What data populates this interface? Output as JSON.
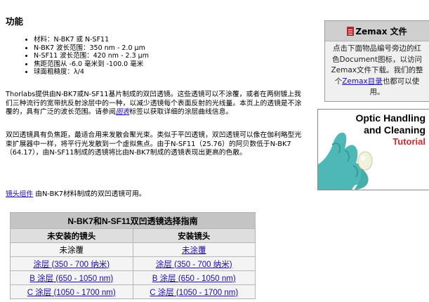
{
  "features": {
    "heading": "功能",
    "items": [
      "材料：N-BK7 或 N-SF11",
      "N-BK7 波长范围：350 nm - 2.0 μm",
      "N-SF11 波长范围：420 nm - 2.3 μm",
      "焦距范围从 -6.0 毫米到 -100.0 毫米",
      "球面粗糙度：λ/4"
    ]
  },
  "paragraphs": {
    "p1_a": "Thorlabs提供由N-BK7或N-SF11基片制成的双凹透镜。这些透镜可以不涂覆，或者在两侧镀上我们三种流行的宽带抗反射涂层中的一种，以减少透镜每个表面反射的光线量。本页上的透镜是不涂覆的，具有广泛的波长范围。请参阅",
    "p1_link": "图表",
    "p1_b": "标签以获取详细的涂层曲线信息。",
    "p2": "双凹透镜具有负焦距，最适合用来发散会聚光束。类似于平凹透镜，双凹透镜可以像在伽利略型光束扩展器中一样，将平行光发散到一个虚拟焦点。由于N-SF11（25.76）的阿贝数低于N-BK7（64.17），由N-SF11制成的透镜将比由N-BK7制成的透镜表现出更高的色散。",
    "p3_link": "镜头组件",
    "p3_b": " 由N-BK7材料制成的双凹透镜可用。"
  },
  "table": {
    "title": "N-BK7和N-SF11双凹透镜选择指南",
    "col1": "未安装的镜头",
    "col2": "安装镜头",
    "rows": [
      [
        "未涂覆",
        "未涂覆"
      ],
      [
        "涂层 (350 - 700 纳米)",
        "涂层 (350 - 700 纳米)"
      ],
      [
        "B 涂层 (650 - 1050 nm)",
        "B 涂层 (650 - 1050 nm)"
      ],
      [
        "C 涂层 (1050 - 1700 nm)",
        "C 涂层 (1050 - 1700 nm)"
      ]
    ]
  },
  "zemax": {
    "title": "Zemax 文件",
    "text_a": "点击下面物品编号旁边的红色Document图标，以访问Zemax文件下载。我们的整个",
    "link": "Zemax目录",
    "text_b": "也都可以使用。"
  },
  "tutorial": {
    "line1": "Optic Handling",
    "line2": "and Cleaning",
    "line3": "Tutorial"
  },
  "colors": {
    "link": "#1a0dab",
    "pdf_red": "#b3282d",
    "tutorial_red": "#c0302f",
    "glove_teal": "#4db8b5"
  }
}
